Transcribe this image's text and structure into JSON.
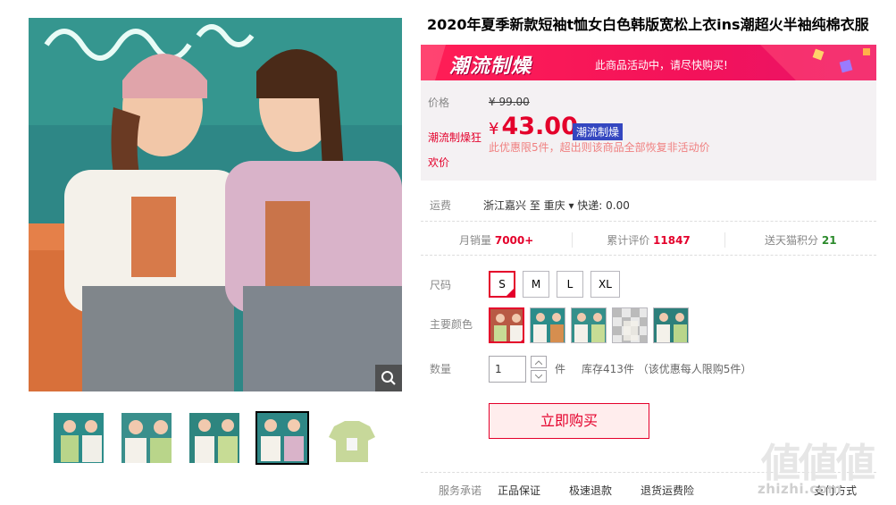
{
  "product": {
    "title": "2020年夏季新款短袖t恤女白色韩版宽松上衣ins潮超火半袖纯棉衣服"
  },
  "promo_banner": {
    "badge": "潮流制燥",
    "text": "此商品活动中，请尽快购买!"
  },
  "price": {
    "label": "价格",
    "old_price": "¥ 99.00",
    "promo_label": "潮流制燥狂",
    "promo_label2": "欢价",
    "currency": "¥",
    "current": "43.00",
    "tag": "潮流制燥",
    "note": "此优惠限5件，超出则该商品全部恢复非活动价"
  },
  "shipping": {
    "label": "运费",
    "text": "浙江嘉兴 至 重庆 ▾ 快递: 0.00"
  },
  "stats": {
    "monthly_label": "月销量",
    "monthly_value": "7000+",
    "reviews_label": "累计评价",
    "reviews_value": "11847",
    "points_label": "送天猫积分",
    "points_value": "21"
  },
  "sizes": {
    "label": "尺码",
    "options": [
      "S",
      "M",
      "L",
      "XL"
    ],
    "selected": "S"
  },
  "colors": {
    "label": "主要颜色"
  },
  "quantity": {
    "label": "数量",
    "value": "1",
    "unit": "件",
    "stock": "库存413件 （该优惠每人限购5件）"
  },
  "buy_button": "立即购买",
  "service": {
    "label": "服务承诺",
    "items": [
      "正品保证",
      "极速退款",
      "退货运费险",
      "支付方式"
    ]
  },
  "watermark": "zhizhi.com",
  "watermark_glyphs": "値値値",
  "colors_palette": {
    "accent": "#e4002b",
    "price_bg": "#f4f1f3",
    "tag_blue": "#3447c0"
  }
}
